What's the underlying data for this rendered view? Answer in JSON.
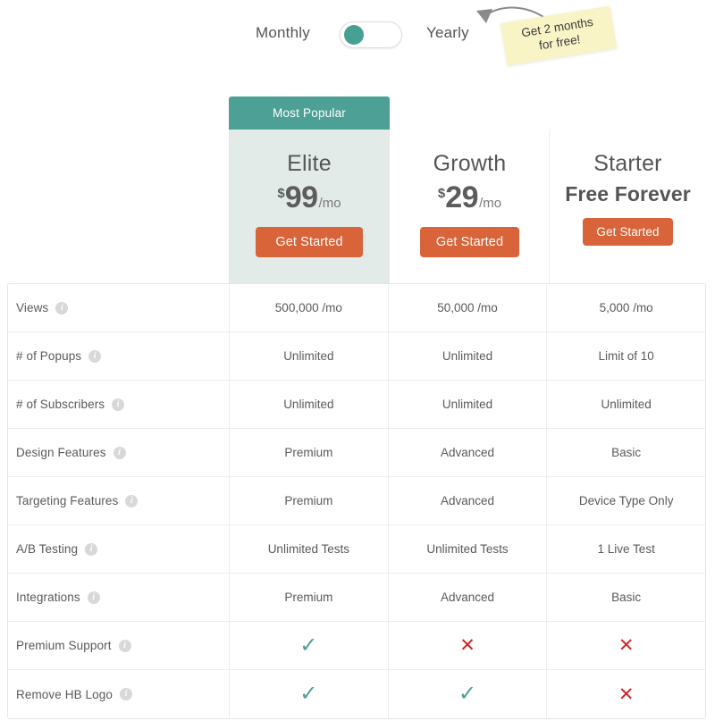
{
  "billing": {
    "monthly_label": "Monthly",
    "yearly_label": "Yearly",
    "toggle_state": "monthly",
    "promo_note_line1": "Get 2 months",
    "promo_note_line2": "for free!"
  },
  "banner": {
    "most_popular_label": "Most Popular"
  },
  "plans": [
    {
      "name": "Elite",
      "currency": "$",
      "amount": "99",
      "period": "/mo",
      "cta_label": "Get Started",
      "highlighted": true
    },
    {
      "name": "Growth",
      "currency": "$",
      "amount": "29",
      "period": "/mo",
      "cta_label": "Get Started",
      "highlighted": false
    },
    {
      "name": "Starter",
      "price_text": "Free Forever",
      "cta_label": "Get Started",
      "highlighted": false
    }
  ],
  "info_icon_glyph": "i",
  "check_glyph": "✓",
  "cross_glyph": "✕",
  "colors": {
    "teal": "#4da096",
    "orange": "#d9643a",
    "red": "#cc2929",
    "highlight_bg": "#e2ebe8",
    "sticky_yellow": "#f8f4c6",
    "text": "#5a5a5a"
  },
  "features": [
    {
      "label": "Views",
      "elite": "500,000 /mo",
      "growth": "50,000 /mo",
      "starter": "5,000 /mo"
    },
    {
      "label": "# of Popups",
      "elite": "Unlimited",
      "growth": "Unlimited",
      "starter": "Limit of 10"
    },
    {
      "label": "# of Subscribers",
      "elite": "Unlimited",
      "growth": "Unlimited",
      "starter": "Unlimited"
    },
    {
      "label": "Design Features",
      "elite": "Premium",
      "growth": "Advanced",
      "starter": "Basic"
    },
    {
      "label": "Targeting Features",
      "elite": "Premium",
      "growth": "Advanced",
      "starter": "Device Type Only"
    },
    {
      "label": "A/B Testing",
      "elite": "Unlimited Tests",
      "growth": "Unlimited Tests",
      "starter": "1 Live Test"
    },
    {
      "label": "Integrations",
      "elite": "Premium",
      "growth": "Advanced",
      "starter": "Basic"
    },
    {
      "label": "Premium Support",
      "elite": "check",
      "growth": "cross",
      "starter": "cross"
    },
    {
      "label": "Remove HB Logo",
      "elite": "check",
      "growth": "check",
      "starter": "cross"
    }
  ]
}
